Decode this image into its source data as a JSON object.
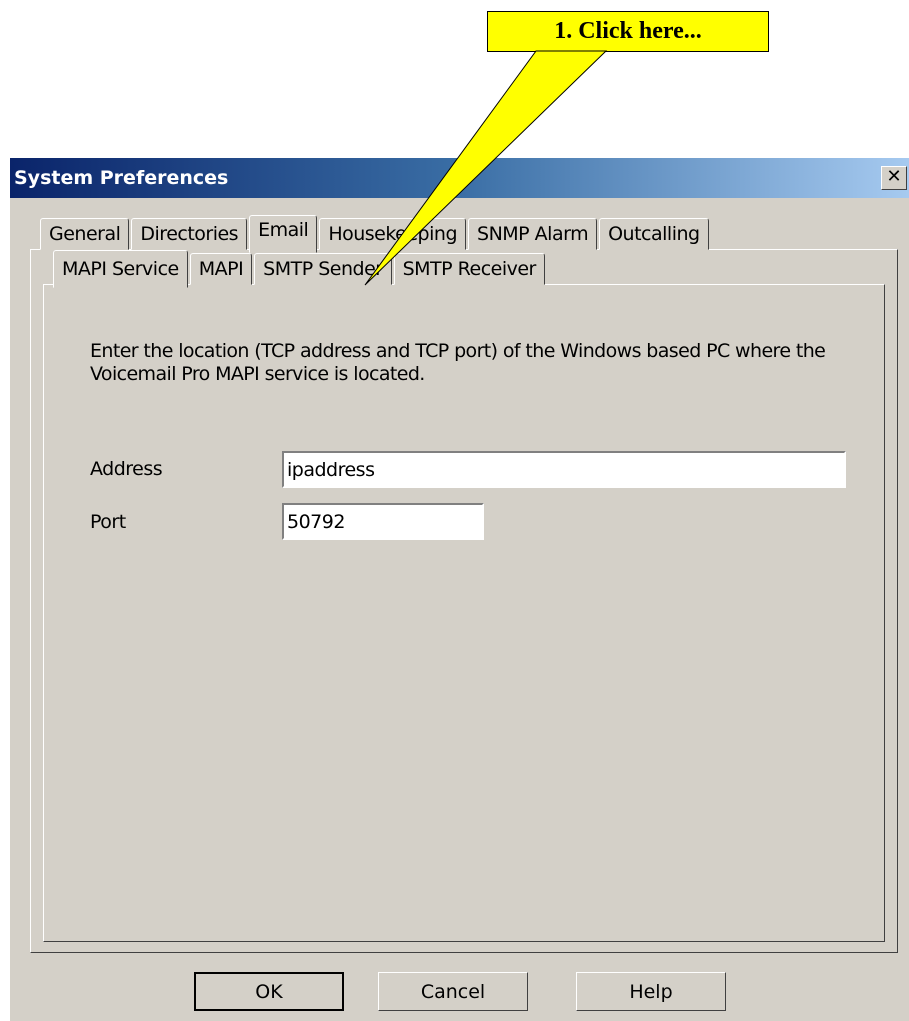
{
  "callout": {
    "text": "1. Click here...",
    "fill_color": "#ffff00"
  },
  "dialog": {
    "title": "System Preferences",
    "close_glyph": "✕",
    "title_bar_color": "#0a246a",
    "face_color": "#d4d0c8"
  },
  "main_tabs": [
    {
      "label": "General",
      "selected": false
    },
    {
      "label": "Directories",
      "selected": false
    },
    {
      "label": "Email",
      "selected": true
    },
    {
      "label": "Housekeeping",
      "selected": false
    },
    {
      "label": "SNMP Alarm",
      "selected": false
    },
    {
      "label": "Outcalling",
      "selected": false
    }
  ],
  "sub_tabs": [
    {
      "label": "MAPI Service",
      "selected": true
    },
    {
      "label": "MAPI",
      "selected": false
    },
    {
      "label": "SMTP Sender",
      "selected": false
    },
    {
      "label": "SMTP Receiver",
      "selected": false
    }
  ],
  "mapi_service": {
    "description": "Enter the location (TCP address and TCP port) of the Windows based PC where the Voicemail Pro MAPI service is located.",
    "address_label": "Address",
    "address_value": "ipaddress",
    "port_label": "Port",
    "port_value": "50792"
  },
  "buttons": {
    "ok": "OK",
    "cancel": "Cancel",
    "help": "Help"
  }
}
